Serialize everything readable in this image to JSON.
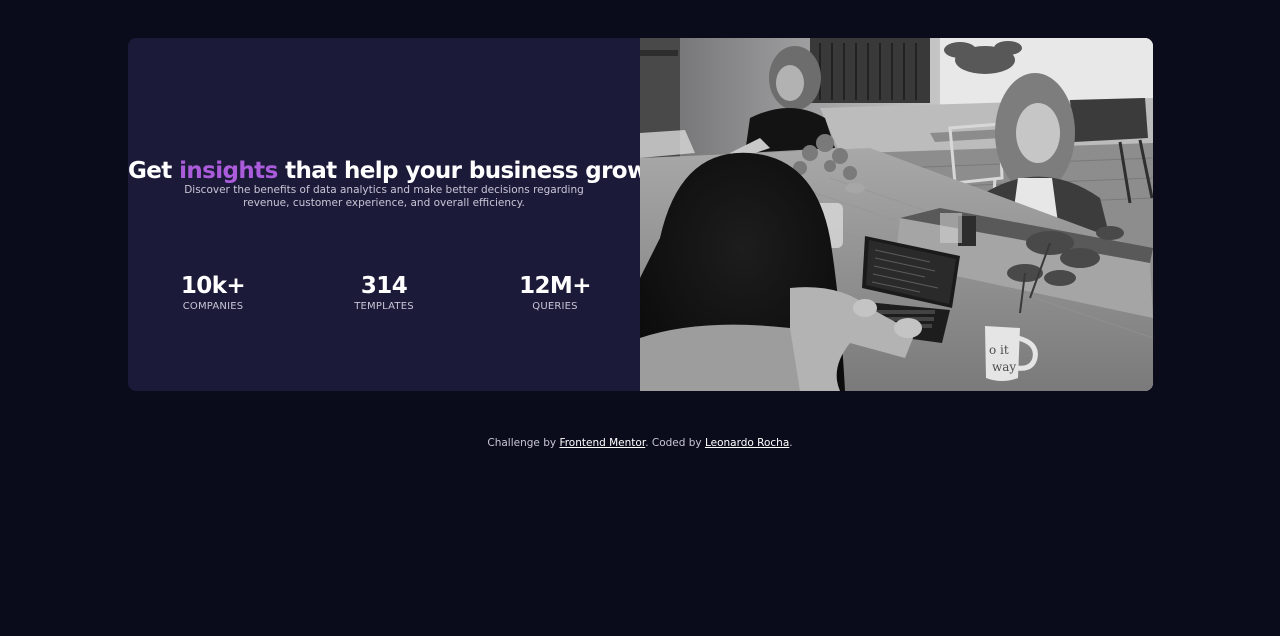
{
  "hero": {
    "headline_before": "Get",
    "headline_accent": "insights",
    "headline_after": "that help your business grow.",
    "description": "Discover the benefits of data analytics and make better decisions regarding revenue, customer experience, and overall efficiency."
  },
  "stats": [
    {
      "value": "10k+",
      "label": "COMPANIES"
    },
    {
      "value": "314",
      "label": "TEMPLATES"
    },
    {
      "value": "12M+",
      "label": "QUERIES"
    }
  ],
  "image": {
    "mug_text_line1": "o it",
    "mug_text_line2": "way"
  },
  "footer": {
    "prefix": "Challenge by",
    "link1": "Frontend Mentor",
    "middle": ". Coded by",
    "link2": "Leonardo Rocha",
    "suffix": "."
  },
  "colors": {
    "page_background": "#0a0c1c",
    "card_background": "#1c1a39",
    "accent": "#aa5cdb",
    "text_primary": "#ffffff",
    "text_secondary": "#c7c6d6"
  }
}
